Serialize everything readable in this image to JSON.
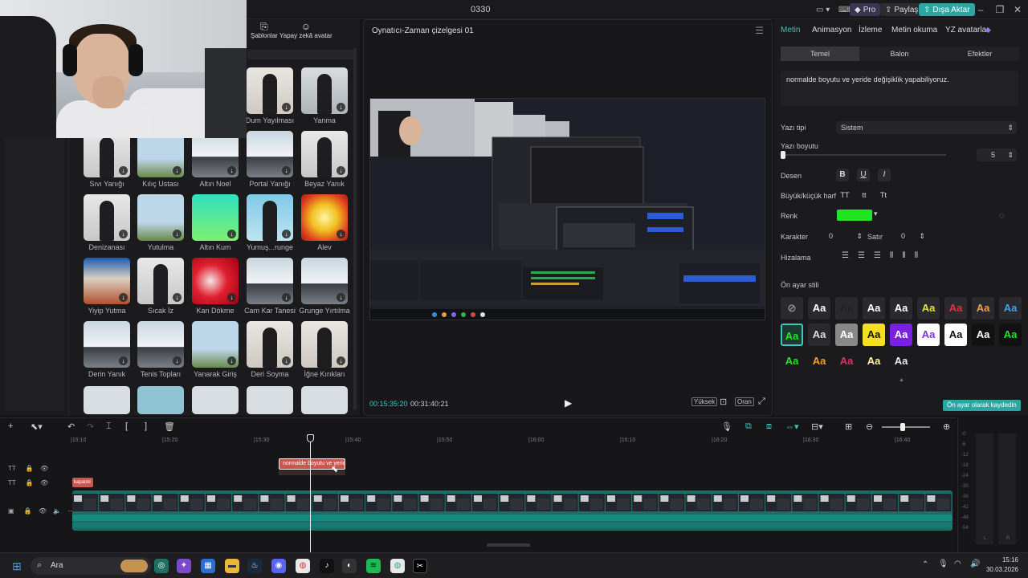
{
  "window": {
    "title": "0330"
  },
  "titlebar": {
    "pro_label": "Pro",
    "share_label": "Paylaş",
    "export_label": "Dışa Aktar"
  },
  "effects": {
    "tabs": [
      {
        "label": "Şablonlar",
        "icon": "template-icon"
      },
      {
        "label": "Yapay zekâ avatar",
        "icon": "avatar-icon"
      }
    ],
    "items": [
      {
        "label": "Dum Yayılması",
        "thumb": "woman"
      },
      {
        "label": "Yanma",
        "thumb": "woman2"
      },
      {
        "label": "Sıvı Yanığı",
        "thumb": "man"
      },
      {
        "label": "Kılıç Ustası",
        "thumb": "tower"
      },
      {
        "label": "Altın Noel",
        "thumb": "mountain"
      },
      {
        "label": "Portal Yanığı",
        "thumb": "mountain"
      },
      {
        "label": "Beyaz Yanık",
        "thumb": "man"
      },
      {
        "label": "Denizanası",
        "thumb": "man"
      },
      {
        "label": "Yutulma",
        "thumb": "tower"
      },
      {
        "label": "Altın Kum",
        "thumb": "green"
      },
      {
        "label": "Yumuş...runge",
        "thumb": "man2"
      },
      {
        "label": "Alev",
        "thumb": "explosion"
      },
      {
        "label": "Yiyip Yutma",
        "thumb": "cartoon"
      },
      {
        "label": "Sıcak İz",
        "thumb": "man"
      },
      {
        "label": "Kan Dökme",
        "thumb": "red"
      },
      {
        "label": "Cam Kar Tanesi",
        "thumb": "mountain"
      },
      {
        "label": "Grunge Yırtılma",
        "thumb": "mountain"
      },
      {
        "label": "Derin Yanık",
        "thumb": "mountain"
      },
      {
        "label": "Tenis Topları",
        "thumb": "mountain"
      },
      {
        "label": "Yanarak Giriş",
        "thumb": "tower"
      },
      {
        "label": "Deri Soyma",
        "thumb": "woman"
      },
      {
        "label": "İğne Kırıkları",
        "thumb": "woman"
      }
    ]
  },
  "player": {
    "title": "Oynatıcı-Zaman çizelgesi 01",
    "timecode_current": "00:15:35:20",
    "timecode_total": "00:31:40:21",
    "quality_label": "Yüksek",
    "ratio_label": "Oran"
  },
  "right": {
    "tabs": [
      "Metin",
      "Animasyon",
      "İzleme",
      "Metin okuma",
      "YZ avatarlar"
    ],
    "subtabs": [
      "Temel",
      "Balon",
      "Efektler"
    ],
    "text_content": "normalde boyutu ve yeride değişiklik yapabiliyoruz.",
    "font_label": "Yazı tipi",
    "font_value": "Sistem",
    "size_label": "Yazı boyutu",
    "size_value": "5",
    "pattern_label": "Desen",
    "case_label": "Büyük/küçük harf",
    "color_label": "Renk",
    "color_value": "#22e522",
    "char_label": "Karakter",
    "char_value": "0",
    "line_label": "Satır",
    "line_value": "0",
    "align_label": "Hizalama",
    "preset_label": "Ön ayar stili",
    "preset_text": "Aa",
    "save_preset_label": "Ön ayar olarak kaydedin"
  },
  "timeline": {
    "ruler": [
      "|15:10",
      "|15:20",
      "|15:30",
      "|15:40",
      "|15:50",
      "|16:00",
      "|16:10",
      "|16:20",
      "|16:30",
      "|16:40"
    ],
    "text_clip": "normalde boyutu ve yerid",
    "small_clip": "kapatıkl"
  },
  "meters": {
    "labels": [
      "-0",
      "-6",
      "-12",
      "-18",
      "-24",
      "-30",
      "-36",
      "-42",
      "-48",
      "-54"
    ],
    "channel_l": "L",
    "channel_r": "R"
  },
  "taskbar": {
    "search_placeholder": "Ara",
    "time": "15:16",
    "date": "30.03.2026"
  }
}
